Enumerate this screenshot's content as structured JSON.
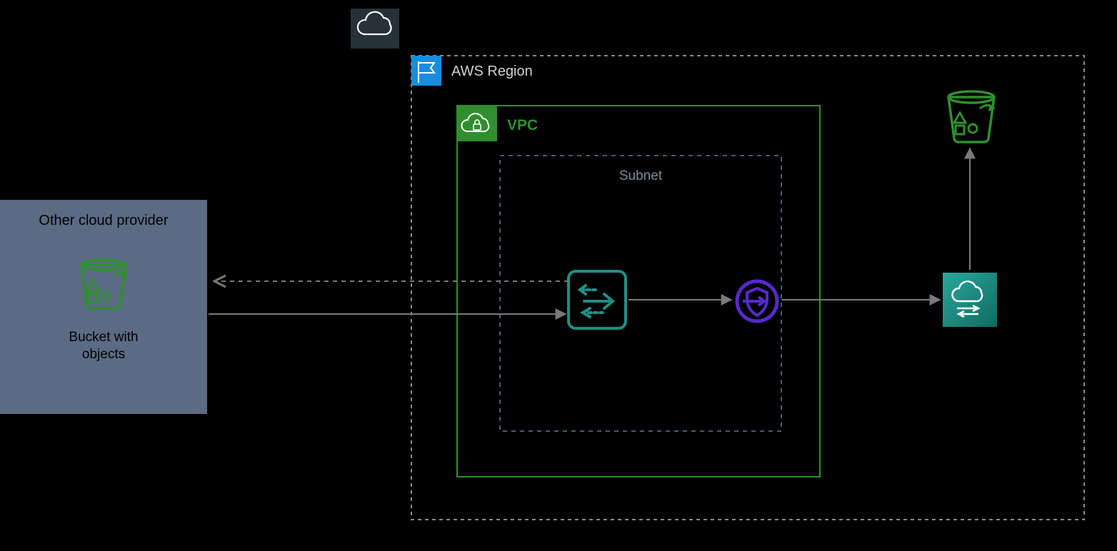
{
  "cloud_box": {
    "title": "Other cloud provider",
    "bucket_caption": "Bucket with objects"
  },
  "aws": {
    "region_label": "AWS Region",
    "vpc_label": "VPC",
    "subnet_label": "Subnet"
  },
  "colors": {
    "slate": "#5b6b84",
    "green": "#2f8f2f",
    "dark_green": "#3b8a3b",
    "teal": "#1f7f77",
    "teal_fill": "#1f8f85",
    "purple": "#5529cc",
    "blue_badge": "#158fdd",
    "dark_tile": "#263238",
    "gray_dash": "#8a8a8a",
    "subnet_dash": "#4a5b72"
  }
}
